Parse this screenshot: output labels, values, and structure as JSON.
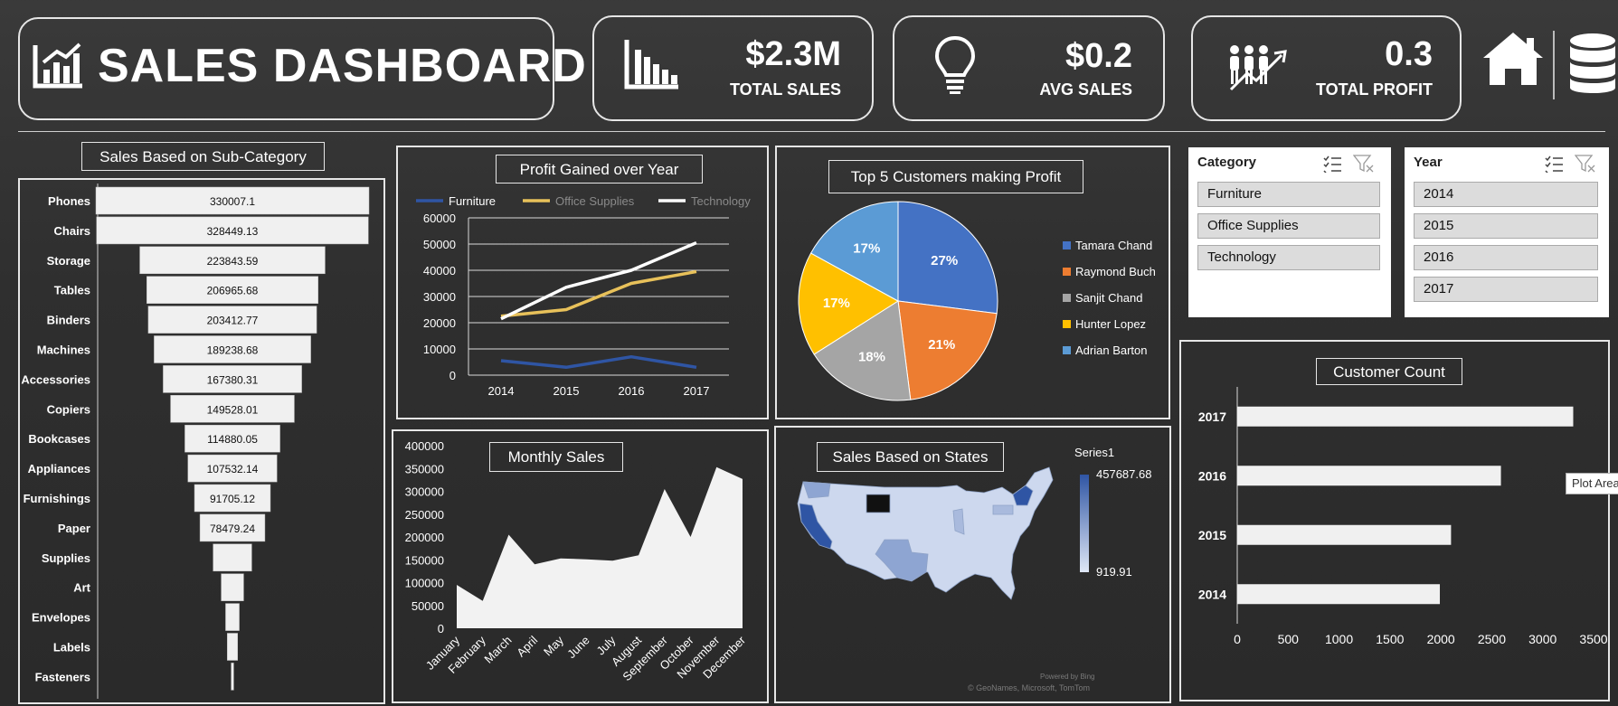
{
  "header": {
    "title": "SALES DASHBOARD"
  },
  "kpis": {
    "total_sales": {
      "value": "$2.3M",
      "label": "TOTAL SALES"
    },
    "avg_sales": {
      "value": "$0.2",
      "label": "AVG SALES"
    },
    "total_profit": {
      "value": "0.3",
      "label": "TOTAL PROFIT"
    }
  },
  "slicers": {
    "category": {
      "title": "Category",
      "items": [
        "Furniture",
        "Office Supplies",
        "Technology"
      ]
    },
    "year": {
      "title": "Year",
      "items": [
        "2014",
        "2015",
        "2016",
        "2017"
      ]
    }
  },
  "tooltip": "Plot Area",
  "map": {
    "title": "Sales Based on States",
    "legend_title": "Series1",
    "max_label": "457687.68",
    "min_label": "919.91",
    "credit1": "Powered by Bing",
    "credit2": "© GeoNames, Microsoft, TomTom"
  },
  "colors": {
    "furniture": "#2f55a4",
    "office_supplies": "#e8c15a",
    "technology": "#ffffff",
    "bar_fill": "#f0f0f0",
    "pie": [
      "#4472c4",
      "#ed7d31",
      "#a5a5a5",
      "#ffc000",
      "#5b9bd5"
    ]
  },
  "chart_data": [
    {
      "id": "subcategory",
      "type": "bar",
      "title": "Sales Based on Sub-Category",
      "categories": [
        "Phones",
        "Chairs",
        "Storage",
        "Tables",
        "Binders",
        "Machines",
        "Accessories",
        "Copiers",
        "Bookcases",
        "Appliances",
        "Furnishings",
        "Paper",
        "Supplies",
        "Art",
        "Envelopes",
        "Labels",
        "Fasteners"
      ],
      "values": [
        330007.1,
        328449.13,
        223843.59,
        206965.68,
        203412.77,
        189238.68,
        167380.31,
        149528.01,
        114880.05,
        107532.14,
        91705.12,
        78479.24,
        46673.54,
        27118.79,
        16476.4,
        12486.31,
        3024.28
      ],
      "labels": [
        "330007.1",
        "328449.13",
        "223843.59",
        "206965.68",
        "203412.77",
        "189238.68",
        "167380.31",
        "149528.01",
        "114880.05",
        "107532.14",
        "91705.12",
        "78479.24",
        "",
        "",
        "",
        "",
        ""
      ]
    },
    {
      "id": "profit",
      "type": "line",
      "title": "Profit Gained over Year",
      "x": [
        "2014",
        "2015",
        "2016",
        "2017"
      ],
      "series": [
        {
          "name": "Furniture",
          "values": [
            5500,
            3000,
            7000,
            3000
          ]
        },
        {
          "name": "Office Supplies",
          "values": [
            22500,
            25000,
            35000,
            39500
          ]
        },
        {
          "name": "Technology",
          "values": [
            21500,
            33500,
            40000,
            50500
          ]
        }
      ],
      "yticks": [
        "0",
        "10000",
        "20000",
        "30000",
        "40000",
        "50000",
        "60000"
      ],
      "ylim": [
        0,
        60000
      ],
      "grid": true,
      "legend": "top"
    },
    {
      "id": "customers",
      "type": "pie",
      "title": "Top 5 Customers making Profit",
      "categories": [
        "Tamara Chand",
        "Raymond Buch",
        "Sanjit Chand",
        "Hunter Lopez",
        "Adrian Barton"
      ],
      "values": [
        27,
        21,
        18,
        17,
        17
      ],
      "labels": [
        "27%",
        "21%",
        "18%",
        "17%",
        "17%"
      ],
      "legend": "right"
    },
    {
      "id": "monthly",
      "type": "area",
      "title": "Monthly Sales",
      "x": [
        "January",
        "February",
        "March",
        "April",
        "May",
        "June",
        "July",
        "August",
        "September",
        "October",
        "November",
        "December"
      ],
      "values": [
        95000,
        60000,
        205000,
        140000,
        153000,
        151000,
        148000,
        160000,
        305000,
        200000,
        353000,
        327000
      ],
      "yticks": [
        "0",
        "50000",
        "100000",
        "150000",
        "200000",
        "250000",
        "300000",
        "350000",
        "400000"
      ],
      "ylim": [
        0,
        400000
      ]
    },
    {
      "id": "customer_count",
      "type": "bar",
      "title": "Customer Count",
      "categories": [
        "2017",
        "2016",
        "2015",
        "2014"
      ],
      "values": [
        3300,
        2590,
        2100,
        1990
      ],
      "xticks": [
        "0",
        "500",
        "1000",
        "1500",
        "2000",
        "2500",
        "3000",
        "3500"
      ],
      "xlim": [
        0,
        3500
      ]
    }
  ]
}
